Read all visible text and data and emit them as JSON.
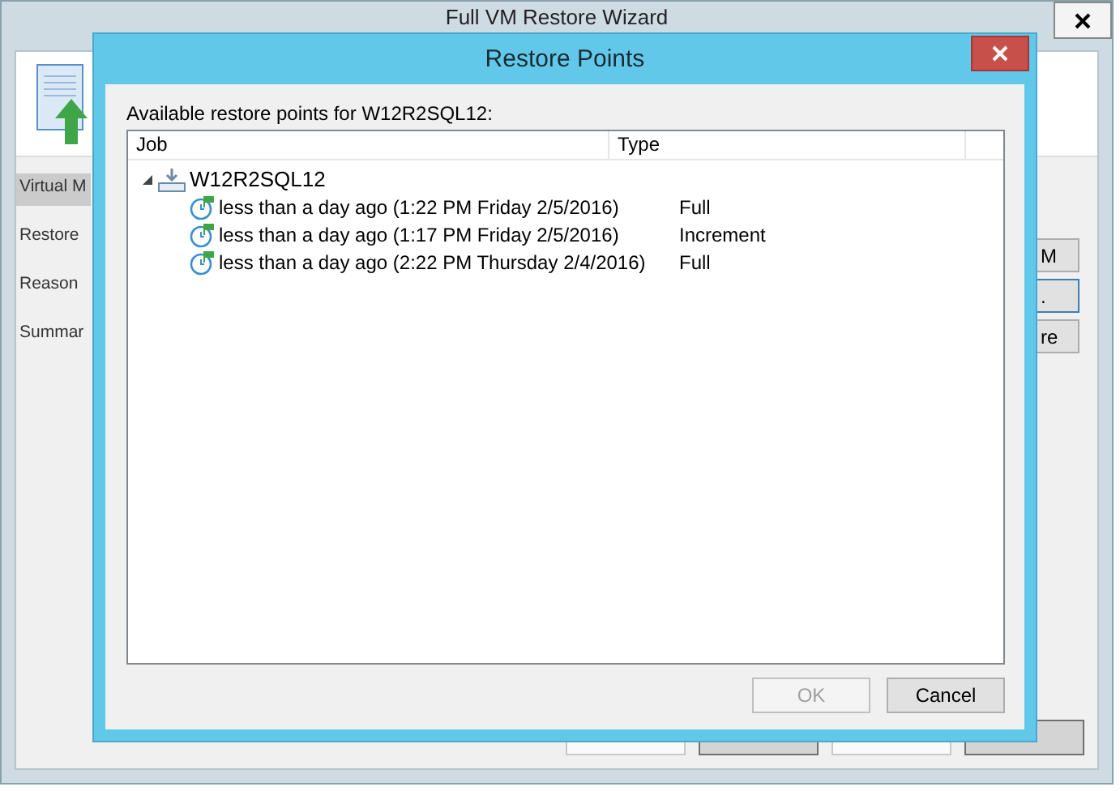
{
  "wizard": {
    "title": "Full VM Restore Wizard",
    "steps": [
      {
        "label": "Virtual M",
        "selected": true
      },
      {
        "label": "Restore",
        "selected": false
      },
      {
        "label": "Reason",
        "selected": false
      },
      {
        "label": "Summar",
        "selected": false
      }
    ],
    "side_buttons": [
      "M",
      ".",
      "re"
    ],
    "buttons": [
      {
        "disabled": true
      },
      {
        "disabled": false
      },
      {
        "disabled": true
      },
      {
        "disabled": false
      }
    ]
  },
  "dialog": {
    "title": "Restore Points",
    "label": "Available restore points for W12R2SQL12:",
    "columns": [
      "Job",
      "Type"
    ],
    "tree": [
      {
        "name": "W12R2SQL12",
        "expanded": true,
        "children": [
          {
            "name": "less than a day ago (1:22 PM Friday 2/5/2016)",
            "type": "Full"
          },
          {
            "name": "less than a day ago (1:17 PM Friday 2/5/2016)",
            "type": "Increment"
          },
          {
            "name": "less than a day ago (2:22 PM Thursday 2/4/2016)",
            "type": "Full"
          }
        ]
      }
    ],
    "buttons": [
      {
        "label": "OK",
        "disabled": true
      },
      {
        "label": "Cancel",
        "disabled": false
      }
    ]
  }
}
